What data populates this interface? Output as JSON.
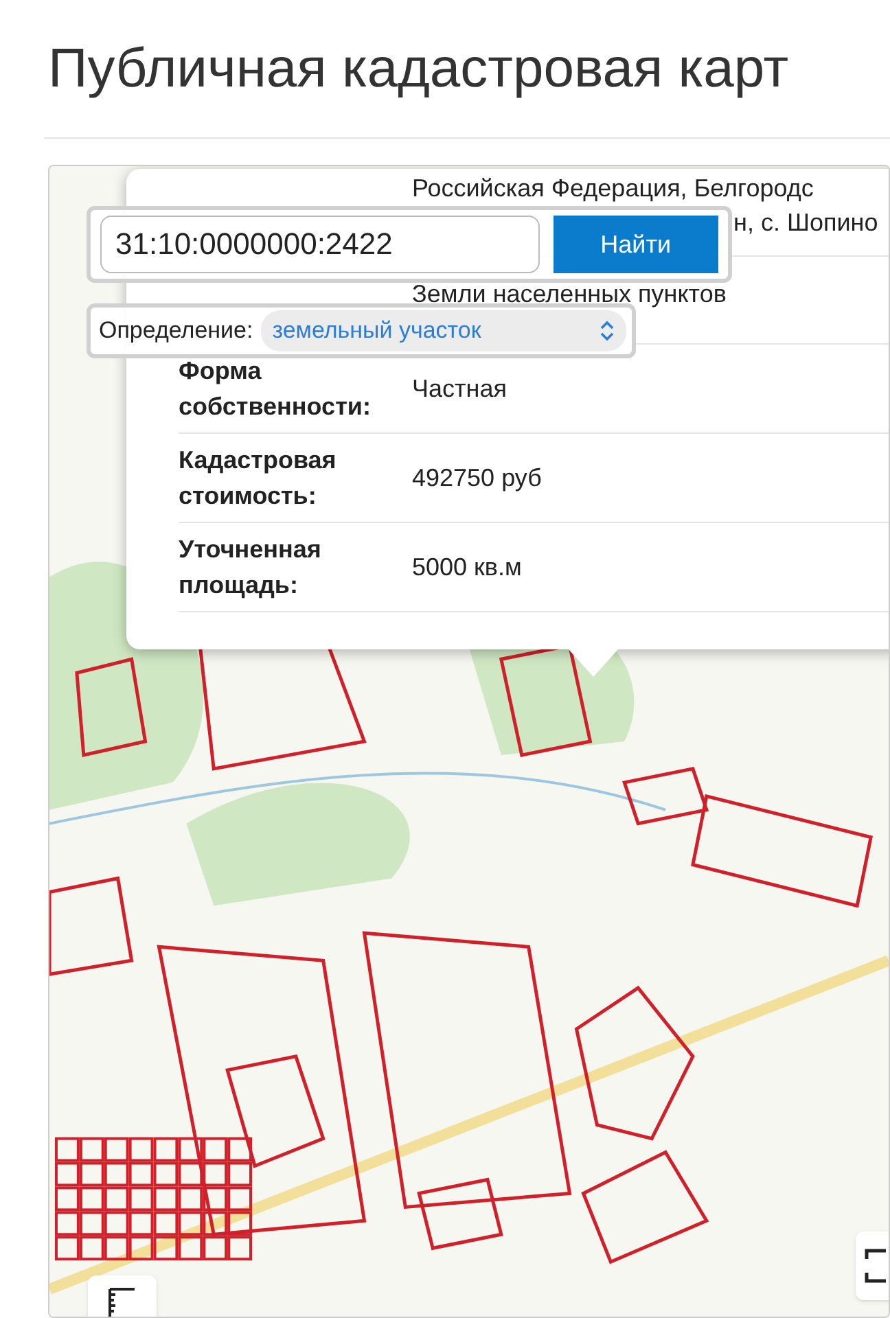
{
  "page_title": "Публичная кадастровая карт",
  "search": {
    "value": "31:10:0000000:2422",
    "button": "Найти"
  },
  "definition": {
    "label": "Определение:",
    "value": "земельный участок"
  },
  "info": {
    "address_lines": [
      "Российская Федерация, Белгородс",
      "н, с. Шопино"
    ],
    "category_value": "Земли населенных пунктов",
    "rows": [
      {
        "label": "Форма собственности:",
        "value": "Частная"
      },
      {
        "label": "Кадастровая стоимость:",
        "value": "492750 руб"
      },
      {
        "label": "Уточненная площадь:",
        "value": "5000 кв.м"
      }
    ]
  }
}
